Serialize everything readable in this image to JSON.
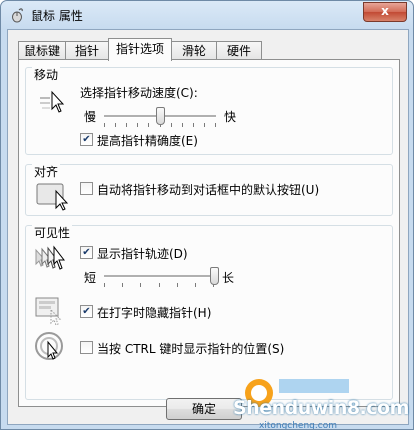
{
  "window": {
    "title": "鼠标 属性",
    "close_glyph": "x"
  },
  "tabs": [
    {
      "label": "鼠标键",
      "active": false
    },
    {
      "label": "指针",
      "active": false
    },
    {
      "label": "指针选项",
      "active": true
    },
    {
      "label": "滑轮",
      "active": false
    },
    {
      "label": "硬件",
      "active": false
    }
  ],
  "motion": {
    "label": "移动",
    "speed_label": "选择指针移动速度(C):",
    "slow_label": "慢",
    "fast_label": "快",
    "speed_level": 0.5,
    "precision_label": "提高指针精确度(E)",
    "precision_checked": true
  },
  "snap": {
    "label": "对齐",
    "checkbox_label": "自动将指针移动到对话框中的默认按钮(U)",
    "checked": false
  },
  "visibility": {
    "label": "可见性",
    "trails_label": "显示指针轨迹(D)",
    "trails_checked": true,
    "short_label": "短",
    "long_label": "长",
    "trails_level": 1.0,
    "hide_label": "在打字时隐藏指针(H)",
    "hide_checked": true,
    "ctrl_label": "当按 CTRL 键时显示指针的位置(S)",
    "ctrl_checked": false
  },
  "buttons": {
    "ok_label": "确定"
  },
  "watermark": {
    "site": "Shenduwin8.com",
    "sub": "xitongcheng.com"
  },
  "icons": {
    "title": "mouse-icon",
    "speed": "pointer-speed-icon",
    "snap": "snap-to-button-icon",
    "trails": "pointer-trails-icon",
    "hide": "hide-pointer-icon",
    "locate": "locate-pointer-icon"
  }
}
